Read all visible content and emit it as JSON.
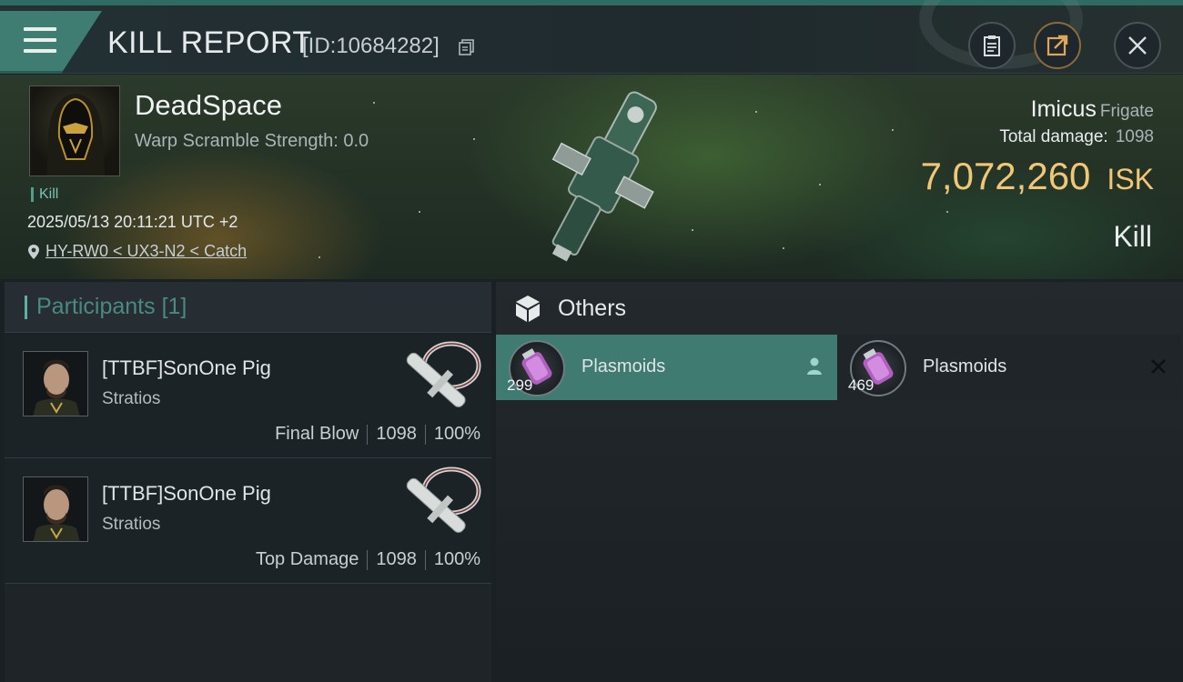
{
  "header": {
    "title": "KILL REPORT",
    "report_id": "[ID:10684282]",
    "icons": [
      "menu-icon",
      "copy-icon",
      "clipboard-icon",
      "share-icon",
      "close-icon"
    ]
  },
  "victim": {
    "pilot_name": "DeadSpace",
    "warp_scramble": "Warp Scramble Strength: 0.0",
    "event_tag": "Kill",
    "timestamp": "2025/05/13 20:11:21 UTC +2",
    "location": "HY-RW0 < UX3-N2 < Catch",
    "ship_name": "Imicus",
    "ship_class": "Frigate",
    "total_damage_label": "Total damage:",
    "total_damage_value": "1098",
    "isk_value": "7,072,260",
    "isk_unit": "ISK",
    "report_type": "Kill"
  },
  "participants": {
    "label": "Participants",
    "count_label": "[1]",
    "rows": [
      {
        "name": "[TTBF]SonOne Pig",
        "ship": "Stratios",
        "role": "Final Blow",
        "damage": "1098",
        "percent": "100%"
      },
      {
        "name": "[TTBF]SonOne Pig",
        "ship": "Stratios",
        "role": "Top Damage",
        "damage": "1098",
        "percent": "100%"
      }
    ]
  },
  "others": {
    "label": "Others",
    "items": [
      {
        "name": "Plasmoids",
        "qty": "299",
        "state": "selected",
        "end_icon": "person-icon"
      },
      {
        "name": "Plasmoids",
        "qty": "469",
        "state": "destroyed",
        "end_icon": "x-icon"
      }
    ]
  },
  "colors": {
    "accent": "#3f7d72",
    "isk": "#f0c777",
    "participants_header": "#4a8a80"
  }
}
